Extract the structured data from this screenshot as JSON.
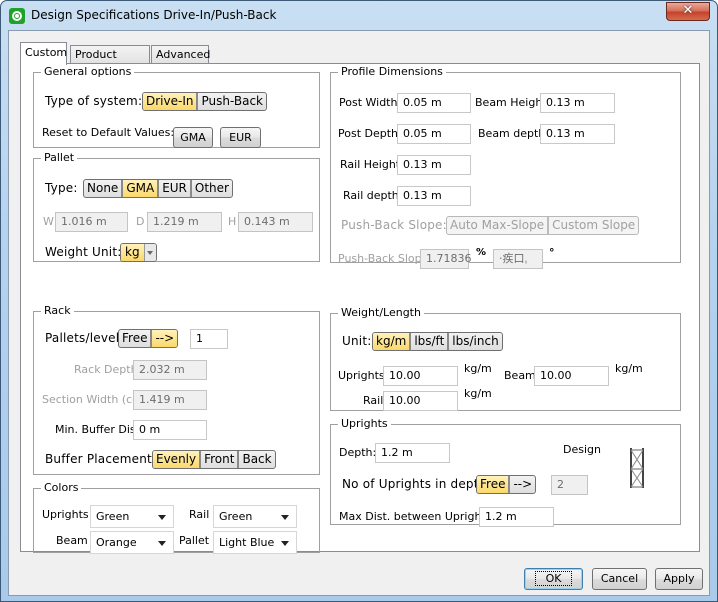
{
  "window": {
    "title": "Design Specifications Drive-In/Push-Back",
    "close_glyph": "✕"
  },
  "tabs": [
    {
      "label": "Custom",
      "active": true
    },
    {
      "label": "Product Series",
      "active": false
    },
    {
      "label": "Advanced",
      "active": false
    }
  ],
  "general": {
    "legend": "General options",
    "type_label": "Type of system:",
    "type_options": [
      "Drive-In",
      "Push-Back"
    ],
    "type_selected": "Drive-In",
    "reset_label": "Reset to Default Values:",
    "reset_gma": "GMA",
    "reset_eur": "EUR"
  },
  "pallet": {
    "legend": "Pallet",
    "type_label": "Type:",
    "type_options": [
      "None",
      "GMA",
      "EUR",
      "Other"
    ],
    "type_selected": "GMA",
    "w_label": "W",
    "w_value": "1.016 m",
    "d_label": "D",
    "d_value": "1.219 m",
    "h_label": "H",
    "h_value": "0.143 m",
    "weight_unit_label": "Weight Unit:",
    "weight_unit_value": "kg"
  },
  "rack": {
    "legend": "Rack",
    "pallets_level_label": "Pallets/level",
    "pallets_level_options": [
      "Free",
      "-->"
    ],
    "pallets_level_selected": "-->",
    "pallets_level_value": "1",
    "rack_depth_label": "Rack Depth",
    "rack_depth_value": "2.032 m",
    "section_width_label": "Section Width (cc)",
    "section_width_value": "1.419 m",
    "min_buffer_label": "Min. Buffer Dist",
    "min_buffer_value": "0 m",
    "buffer_placement_label": "Buffer Placement:",
    "buffer_placement_options": [
      "Evenly",
      "Front",
      "Back"
    ],
    "buffer_placement_selected": "Evenly"
  },
  "colors": {
    "legend": "Colors",
    "uprights_label": "Uprights",
    "uprights_value": "Green",
    "rail_label": "Rail",
    "rail_value": "Green",
    "beam_label": "Beam",
    "beam_value": "Orange",
    "pallet_label": "Pallet",
    "pallet_value": "Light Blue"
  },
  "profile": {
    "legend": "Profile Dimensions",
    "post_width_label": "Post Width",
    "post_width_value": "0.05 m",
    "beam_height_label": "Beam Height",
    "beam_height_value": "0.13 m",
    "post_depth_label": "Post Depth",
    "post_depth_value": "0.05 m",
    "beam_depth_label": "Beam depth",
    "beam_depth_value": "0.13 m",
    "rail_height_label": "Rail Height",
    "rail_height_value": "0.13 m",
    "rail_depth_label": "Rail depth",
    "rail_depth_value": "0.13 m",
    "pb_slope_mode_label": "Push-Back Slope:",
    "pb_slope_mode_options": [
      "Auto Max-Slope",
      "Custom Slope"
    ],
    "pb_slope_label": "Push-Back Slope",
    "pb_slope_percent_value": "1.71836",
    "percent_symbol": "%",
    "pb_slope_degree_value": "·疾口ˌ",
    "degree_symbol": "°"
  },
  "weight_length": {
    "legend": "Weight/Length",
    "unit_label": "Unit:",
    "unit_options": [
      "kg/m",
      "lbs/ft",
      "lbs/inch"
    ],
    "unit_selected": "kg/m",
    "uprights_label": "Uprights",
    "uprights_value": "10.00",
    "uprights_unit": "kg/m",
    "beam_label": "Beam",
    "beam_value": "10.00",
    "beam_unit": "kg/m",
    "rail_label": "Rail",
    "rail_value": "10.00",
    "rail_unit": "kg/m"
  },
  "uprights": {
    "legend": "Uprights",
    "depth_label": "Depth:",
    "depth_value": "1.2 m",
    "design_label": "Design",
    "count_label": "No of Uprights in depth",
    "count_options": [
      "Free",
      "-->"
    ],
    "count_selected": "Free",
    "count_value": "2",
    "max_dist_label": "Max Dist. between Uprights",
    "max_dist_value": "1.2 m"
  },
  "footer": {
    "ok": "OK",
    "cancel": "Cancel",
    "apply": "Apply"
  }
}
